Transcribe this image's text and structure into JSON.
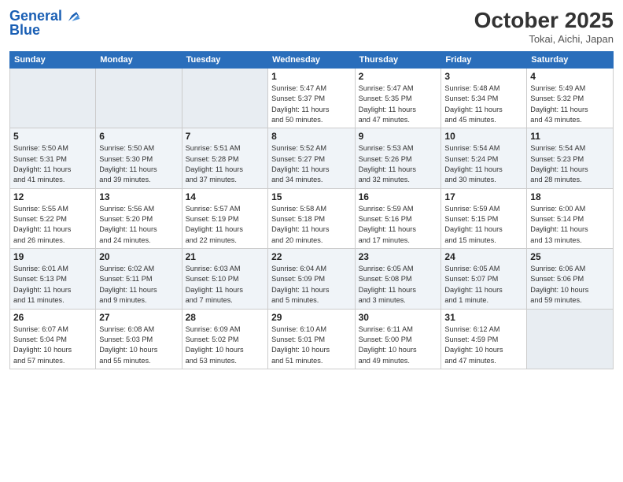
{
  "header": {
    "logo_line1": "General",
    "logo_line2": "Blue",
    "month": "October 2025",
    "location": "Tokai, Aichi, Japan"
  },
  "weekdays": [
    "Sunday",
    "Monday",
    "Tuesday",
    "Wednesday",
    "Thursday",
    "Friday",
    "Saturday"
  ],
  "weeks": [
    [
      {
        "day": "",
        "info": ""
      },
      {
        "day": "",
        "info": ""
      },
      {
        "day": "",
        "info": ""
      },
      {
        "day": "1",
        "info": "Sunrise: 5:47 AM\nSunset: 5:37 PM\nDaylight: 11 hours\nand 50 minutes."
      },
      {
        "day": "2",
        "info": "Sunrise: 5:47 AM\nSunset: 5:35 PM\nDaylight: 11 hours\nand 47 minutes."
      },
      {
        "day": "3",
        "info": "Sunrise: 5:48 AM\nSunset: 5:34 PM\nDaylight: 11 hours\nand 45 minutes."
      },
      {
        "day": "4",
        "info": "Sunrise: 5:49 AM\nSunset: 5:32 PM\nDaylight: 11 hours\nand 43 minutes."
      }
    ],
    [
      {
        "day": "5",
        "info": "Sunrise: 5:50 AM\nSunset: 5:31 PM\nDaylight: 11 hours\nand 41 minutes."
      },
      {
        "day": "6",
        "info": "Sunrise: 5:50 AM\nSunset: 5:30 PM\nDaylight: 11 hours\nand 39 minutes."
      },
      {
        "day": "7",
        "info": "Sunrise: 5:51 AM\nSunset: 5:28 PM\nDaylight: 11 hours\nand 37 minutes."
      },
      {
        "day": "8",
        "info": "Sunrise: 5:52 AM\nSunset: 5:27 PM\nDaylight: 11 hours\nand 34 minutes."
      },
      {
        "day": "9",
        "info": "Sunrise: 5:53 AM\nSunset: 5:26 PM\nDaylight: 11 hours\nand 32 minutes."
      },
      {
        "day": "10",
        "info": "Sunrise: 5:54 AM\nSunset: 5:24 PM\nDaylight: 11 hours\nand 30 minutes."
      },
      {
        "day": "11",
        "info": "Sunrise: 5:54 AM\nSunset: 5:23 PM\nDaylight: 11 hours\nand 28 minutes."
      }
    ],
    [
      {
        "day": "12",
        "info": "Sunrise: 5:55 AM\nSunset: 5:22 PM\nDaylight: 11 hours\nand 26 minutes."
      },
      {
        "day": "13",
        "info": "Sunrise: 5:56 AM\nSunset: 5:20 PM\nDaylight: 11 hours\nand 24 minutes."
      },
      {
        "day": "14",
        "info": "Sunrise: 5:57 AM\nSunset: 5:19 PM\nDaylight: 11 hours\nand 22 minutes."
      },
      {
        "day": "15",
        "info": "Sunrise: 5:58 AM\nSunset: 5:18 PM\nDaylight: 11 hours\nand 20 minutes."
      },
      {
        "day": "16",
        "info": "Sunrise: 5:59 AM\nSunset: 5:16 PM\nDaylight: 11 hours\nand 17 minutes."
      },
      {
        "day": "17",
        "info": "Sunrise: 5:59 AM\nSunset: 5:15 PM\nDaylight: 11 hours\nand 15 minutes."
      },
      {
        "day": "18",
        "info": "Sunrise: 6:00 AM\nSunset: 5:14 PM\nDaylight: 11 hours\nand 13 minutes."
      }
    ],
    [
      {
        "day": "19",
        "info": "Sunrise: 6:01 AM\nSunset: 5:13 PM\nDaylight: 11 hours\nand 11 minutes."
      },
      {
        "day": "20",
        "info": "Sunrise: 6:02 AM\nSunset: 5:11 PM\nDaylight: 11 hours\nand 9 minutes."
      },
      {
        "day": "21",
        "info": "Sunrise: 6:03 AM\nSunset: 5:10 PM\nDaylight: 11 hours\nand 7 minutes."
      },
      {
        "day": "22",
        "info": "Sunrise: 6:04 AM\nSunset: 5:09 PM\nDaylight: 11 hours\nand 5 minutes."
      },
      {
        "day": "23",
        "info": "Sunrise: 6:05 AM\nSunset: 5:08 PM\nDaylight: 11 hours\nand 3 minutes."
      },
      {
        "day": "24",
        "info": "Sunrise: 6:05 AM\nSunset: 5:07 PM\nDaylight: 11 hours\nand 1 minute."
      },
      {
        "day": "25",
        "info": "Sunrise: 6:06 AM\nSunset: 5:06 PM\nDaylight: 10 hours\nand 59 minutes."
      }
    ],
    [
      {
        "day": "26",
        "info": "Sunrise: 6:07 AM\nSunset: 5:04 PM\nDaylight: 10 hours\nand 57 minutes."
      },
      {
        "day": "27",
        "info": "Sunrise: 6:08 AM\nSunset: 5:03 PM\nDaylight: 10 hours\nand 55 minutes."
      },
      {
        "day": "28",
        "info": "Sunrise: 6:09 AM\nSunset: 5:02 PM\nDaylight: 10 hours\nand 53 minutes."
      },
      {
        "day": "29",
        "info": "Sunrise: 6:10 AM\nSunset: 5:01 PM\nDaylight: 10 hours\nand 51 minutes."
      },
      {
        "day": "30",
        "info": "Sunrise: 6:11 AM\nSunset: 5:00 PM\nDaylight: 10 hours\nand 49 minutes."
      },
      {
        "day": "31",
        "info": "Sunrise: 6:12 AM\nSunset: 4:59 PM\nDaylight: 10 hours\nand 47 minutes."
      },
      {
        "day": "",
        "info": ""
      }
    ]
  ]
}
